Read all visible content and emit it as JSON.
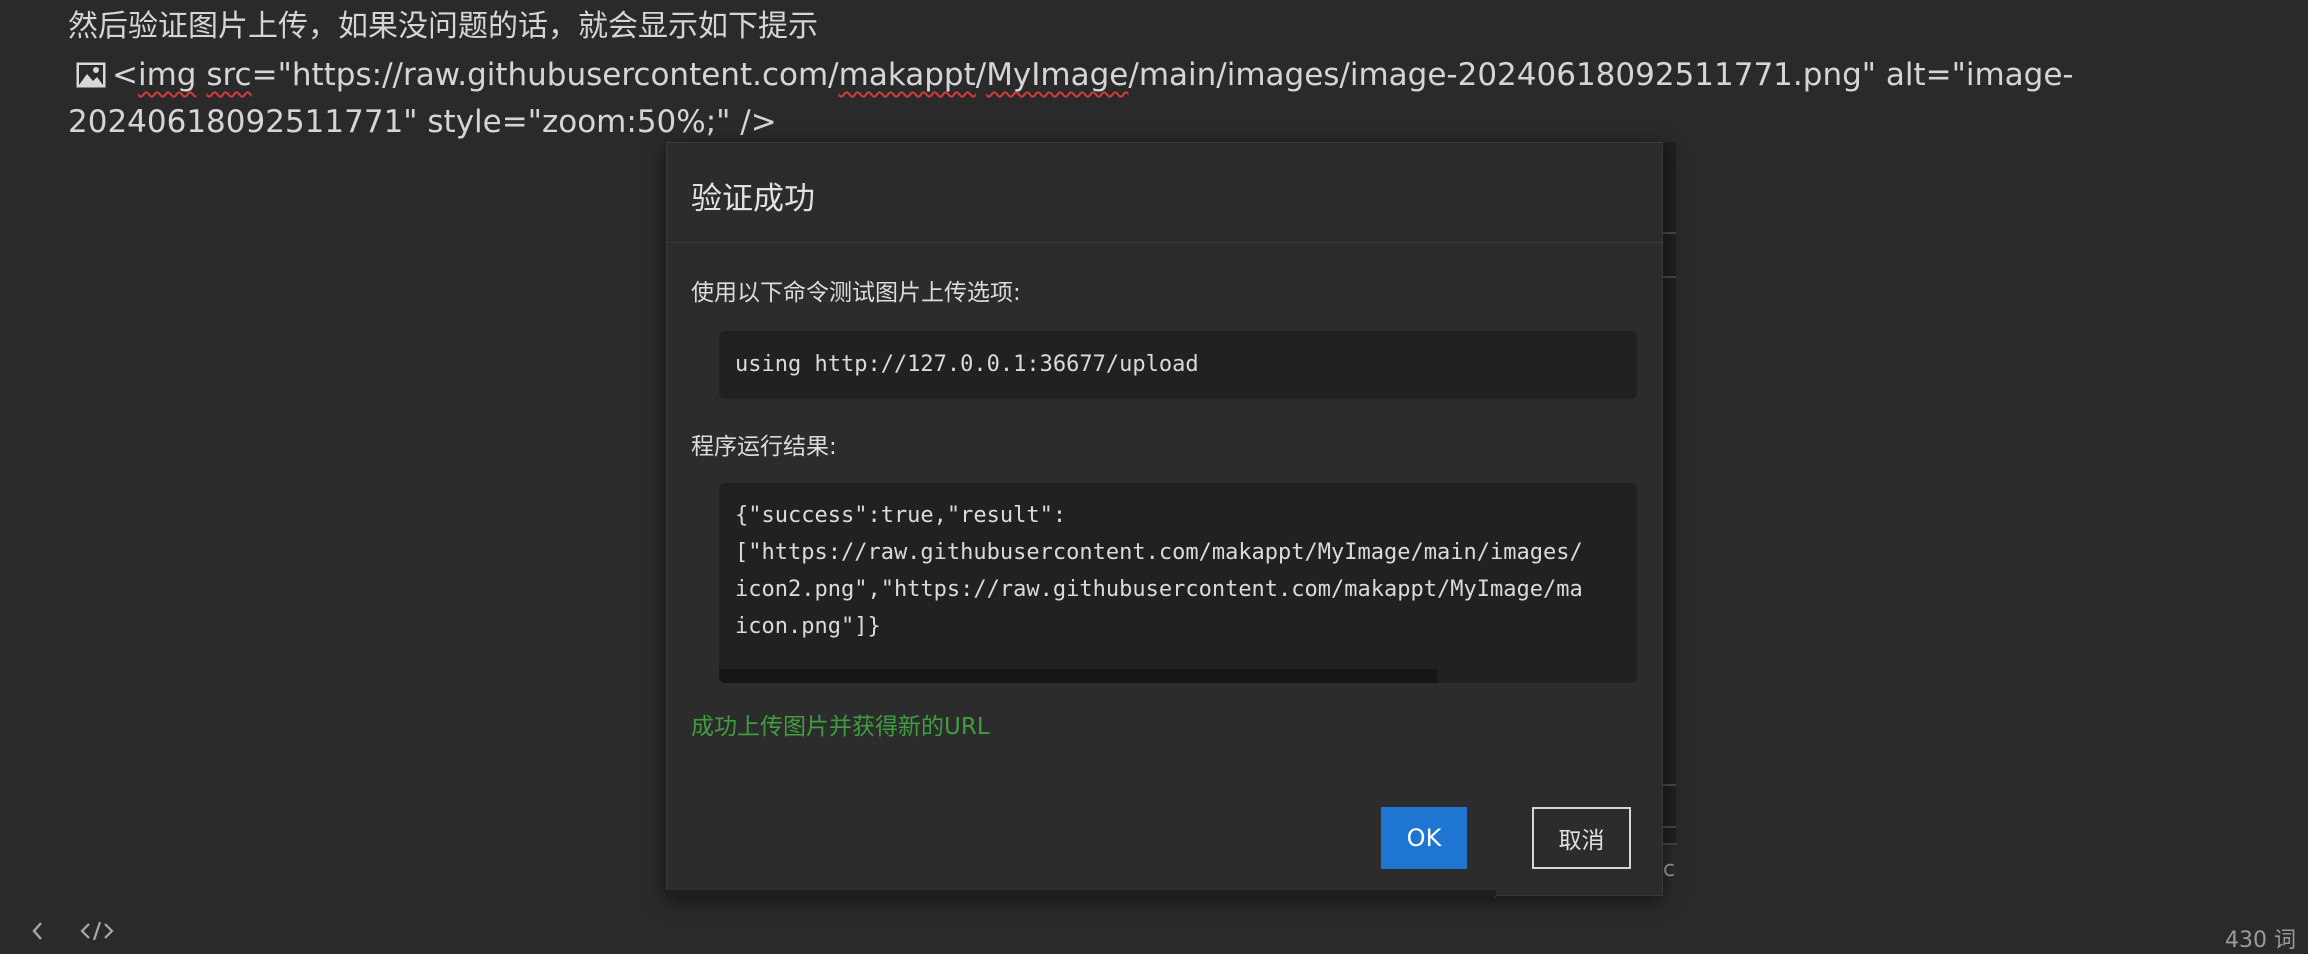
{
  "editor": {
    "paragraph": "然后验证图片上传，如果没问题的话，就会显示如下提示",
    "img_tag": {
      "open": "<",
      "tag": "img",
      "space": " ",
      "attr": "src",
      "eq_quote": "=\"https://raw.githubusercontent.com/",
      "user": "makappt",
      "slash": "/",
      "repo": "MyImage",
      "path_rest": "/main/images/image-20240618092511771.png\" alt=\"image-20240618092511771\" style=\"zoom:50%;\" />"
    }
  },
  "dialog": {
    "title": "验证成功",
    "command_label": "使用以下命令测试图片上传选项:",
    "command": "using http://127.0.0.1:36677/upload",
    "result_label": "程序运行结果:",
    "result_lines": [
      "{\"success\":true,\"result\":",
      "[\"https://raw.githubusercontent.com/makappt/MyImage/main/images/",
      "icon2.png\",\"https://raw.githubusercontent.com/makappt/MyImage/ma",
      "icon.png\"]}"
    ],
    "success_message": "成功上传图片并获得新的URL",
    "ok_label": "OK",
    "cancel_label": "取消"
  },
  "background_fragment_text": "c",
  "statusbar": {
    "back_icon": "chevron-left-icon",
    "source_icon": "code-icon",
    "word_count": "430 词"
  },
  "colors": {
    "background": "#2a2a2b",
    "dialog": "#2c2c2d",
    "primary_button": "#1f76d2",
    "success_text": "#3e9e3e"
  }
}
